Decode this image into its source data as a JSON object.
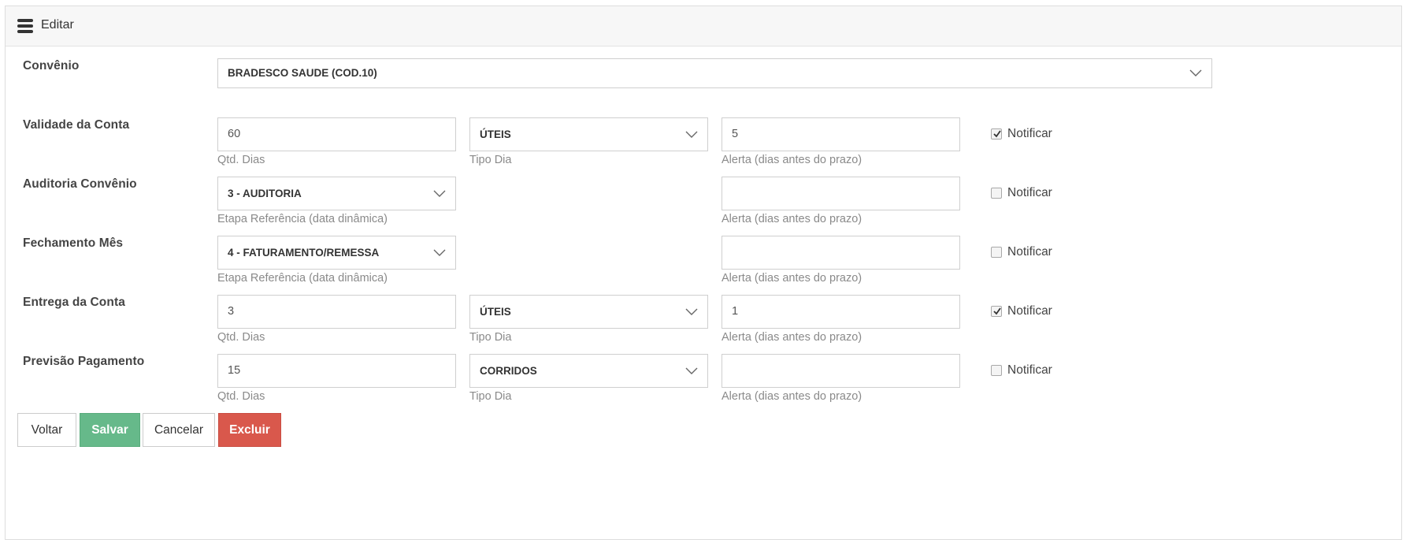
{
  "header": {
    "title": "Editar",
    "icon": "bars-icon"
  },
  "form": {
    "convenio": {
      "label": "Convênio",
      "value": "BRADESCO SAUDE (COD.10)"
    },
    "rows": [
      {
        "label": "Validade da Conta",
        "qty": "60",
        "qty_hint": "Qtd. Dias",
        "tipo": "ÚTEIS",
        "tipo_hint": "Tipo Dia",
        "alerta": "5",
        "alerta_hint": "Alerta (dias antes do prazo)",
        "notify_label": "Notificar",
        "notify_checked": true
      },
      {
        "label": "Auditoria Convênio",
        "etapa": "3 - AUDITORIA",
        "etapa_hint": "Etapa Referência (data dinâmica)",
        "alerta": "",
        "alerta_hint": "Alerta (dias antes do prazo)",
        "notify_label": "Notificar",
        "notify_checked": false
      },
      {
        "label": "Fechamento Mês",
        "etapa": "4 - FATURAMENTO/REMESSA",
        "etapa_hint": "Etapa Referência (data dinâmica)",
        "alerta": "",
        "alerta_hint": "Alerta (dias antes do prazo)",
        "notify_label": "Notificar",
        "notify_checked": false
      },
      {
        "label": "Entrega da Conta",
        "qty": "3",
        "qty_hint": "Qtd. Dias",
        "tipo": "ÚTEIS",
        "tipo_hint": "Tipo Dia",
        "alerta": "1",
        "alerta_hint": "Alerta (dias antes do prazo)",
        "notify_label": "Notificar",
        "notify_checked": true
      },
      {
        "label": "Previsão Pagamento",
        "qty": "15",
        "qty_hint": "Qtd. Dias",
        "tipo": "CORRIDOS",
        "tipo_hint": "Tipo Dia",
        "alerta": "",
        "alerta_hint": "Alerta (dias antes do prazo)",
        "notify_label": "Notificar",
        "notify_checked": false
      }
    ]
  },
  "buttons": {
    "voltar": "Voltar",
    "salvar": "Salvar",
    "cancelar": "Cancelar",
    "excluir": "Excluir"
  },
  "colors": {
    "success": "#66b98a",
    "danger": "#d9584c",
    "border": "#cfcfcf"
  }
}
